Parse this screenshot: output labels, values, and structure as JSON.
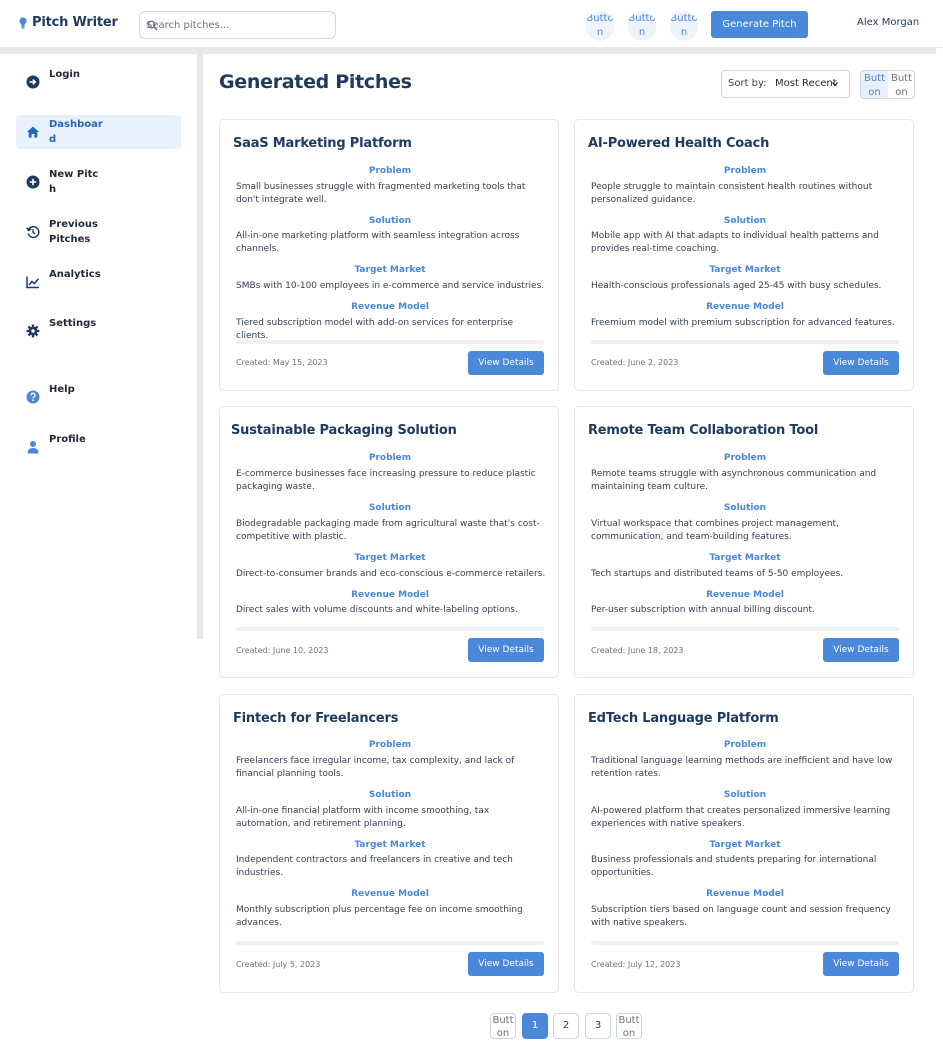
{
  "header": {
    "brand": "Pitch Writer",
    "search_placeholder": "Search pitches...",
    "icon_buttons": [
      "Button",
      "Button",
      "Button"
    ],
    "generate_label": "Generate Pitch",
    "user_name": "Alex Morgan"
  },
  "sidebar": {
    "items": [
      {
        "label": "Login",
        "icon": "login-icon"
      },
      {
        "label": "Dashboard",
        "icon": "home-icon",
        "active": true
      },
      {
        "label": "New Pitch",
        "icon": "plus-circle-icon"
      },
      {
        "label": "Previous Pitches",
        "icon": "history-icon"
      },
      {
        "label": "Analytics",
        "icon": "chart-line-icon"
      },
      {
        "label": "Settings",
        "icon": "gear-icon"
      },
      {
        "label": "Help",
        "icon": "question-circle-icon"
      },
      {
        "label": "Profile",
        "icon": "user-icon"
      }
    ]
  },
  "main": {
    "title": "Generated Pitches",
    "sort_label": "Sort by:",
    "sort_value": "Most Recent",
    "view_grid_label": "Button",
    "view_list_label": "Button",
    "section_labels": {
      "problem": "Problem",
      "solution": "Solution",
      "target": "Target Market",
      "revenue": "Revenue Model"
    },
    "view_details_label": "View Details",
    "pitches": [
      {
        "title": "SaaS Marketing Platform",
        "problem": "Small businesses struggle with fragmented marketing tools that don't integrate well.",
        "solution": "All-in-one marketing platform with seamless integration across channels.",
        "target": "SMBs with 10-100 employees in e-commerce and service industries.",
        "revenue": "Tiered subscription model with add-on services for enterprise clients.",
        "created": "Created: May 15, 2023"
      },
      {
        "title": "AI-Powered Health Coach",
        "problem": "People struggle to maintain consistent health routines without personalized guidance.",
        "solution": "Mobile app with AI that adapts to individual health patterns and provides real-time coaching.",
        "target": "Health-conscious professionals aged 25-45 with busy schedules.",
        "revenue": "Freemium model with premium subscription for advanced features.",
        "created": "Created: June 2, 2023"
      },
      {
        "title": "Sustainable Packaging Solution",
        "problem": "E-commerce businesses face increasing pressure to reduce plastic packaging waste.",
        "solution": "Biodegradable packaging made from agricultural waste that's cost-competitive with plastic.",
        "target": "Direct-to-consumer brands and eco-conscious e-commerce retailers.",
        "revenue": "Direct sales with volume discounts and white-labeling options.",
        "created": "Created: June 10, 2023"
      },
      {
        "title": "Remote Team Collaboration Tool",
        "problem": "Remote teams struggle with asynchronous communication and maintaining team culture.",
        "solution": "Virtual workspace that combines project management, communication, and team-building features.",
        "target": "Tech startups and distributed teams of 5-50 employees.",
        "revenue": "Per-user subscription with annual billing discount.",
        "created": "Created: June 18, 2023"
      },
      {
        "title": "Fintech for Freelancers",
        "problem": "Freelancers face irregular income, tax complexity, and lack of financial planning tools.",
        "solution": "All-in-one financial platform with income smoothing, tax automation, and retirement planning.",
        "target": "Independent contractors and freelancers in creative and tech industries.",
        "revenue": "Monthly subscription plus percentage fee on income smoothing advances.",
        "created": "Created: July 5, 2023"
      },
      {
        "title": "EdTech Language Platform",
        "problem": "Traditional language learning methods are inefficient and have low retention rates.",
        "solution": "AI-powered platform that creates personalized immersive learning experiences with native speakers.",
        "target": "Business professionals and students preparing for international opportunities.",
        "revenue": "Subscription tiers based on language count and session frequency with native speakers.",
        "created": "Created: July 12, 2023"
      }
    ]
  },
  "pagination": {
    "prev_label": "Button",
    "pages": [
      "1",
      "2",
      "3"
    ],
    "current": "1",
    "next_label": "Button"
  },
  "colors": {
    "accent": "#4a88d9",
    "heading": "#1e3a5f",
    "active_bg": "#e8f0fb"
  }
}
